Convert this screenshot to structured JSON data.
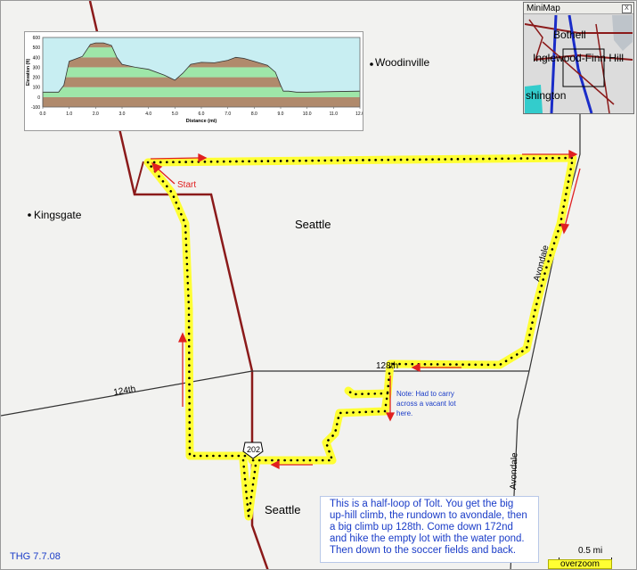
{
  "map": {
    "places": {
      "woodinville": "Woodinville",
      "kingsgate": "Kingsgate",
      "seattle_top": "Seattle",
      "seattle_bottom": "Seattle"
    },
    "roads": {
      "r124th": "124th",
      "r128th": "128th",
      "avondale_upper": "Avondale",
      "avondale_lower": "Avondale",
      "shield_202": "202"
    },
    "start_label": "Start",
    "note_pin": "Note: Had to carry\nacross a vacant lot\nhere.",
    "route_color": "#ffff33",
    "road_color": "#8b1a1a",
    "arrow_color": "#e02020"
  },
  "note_box": "This is a half-loop of Tolt. You get the big up-hill climb, the rundown to avondale, then a big climb up 128th. Come down 172nd and hike the empty lot with the water pond. Then down to the soccer fields and back.",
  "credit": "THG 7.7.08",
  "scale": {
    "label": "0.5 mi",
    "overzoom": "overzoom"
  },
  "minimap": {
    "title": "MiniMap",
    "close": "X",
    "labels": {
      "bothell": "Bothell",
      "inglewood": "Inglewood-Finn Hill",
      "washington": "shington"
    }
  },
  "profile": {
    "ylabel": "Elevation (ft)",
    "xlabel": "Distance  (mi)",
    "y_ticks": [
      "600",
      "500",
      "400",
      "300",
      "200",
      "100",
      "0",
      "-100"
    ],
    "x_ticks": [
      "0.0",
      "1.0",
      "2.0",
      "3.0",
      "4.0",
      "5.0",
      "6.0",
      "7.0",
      "8.0",
      "9.0",
      "10.0",
      "11.0",
      "12.0"
    ]
  },
  "chart_data": {
    "type": "area",
    "xlabel": "Distance  (mi)",
    "ylabel": "Elevation (ft)",
    "xlim": [
      0,
      12
    ],
    "ylim": [
      -100,
      600
    ],
    "x": [
      0.0,
      0.6,
      0.8,
      1.0,
      1.5,
      1.8,
      2.0,
      2.3,
      2.6,
      2.8,
      3.0,
      3.5,
      4.0,
      4.6,
      5.0,
      5.3,
      5.6,
      6.0,
      6.5,
      7.0,
      7.3,
      7.6,
      8.0,
      8.5,
      8.8,
      9.0,
      9.1,
      9.3,
      9.6,
      10.0,
      11.0,
      12.0
    ],
    "values": [
      50,
      50,
      120,
      360,
      410,
      530,
      545,
      545,
      520,
      400,
      330,
      300,
      280,
      220,
      170,
      240,
      330,
      350,
      345,
      370,
      400,
      390,
      360,
      320,
      250,
      120,
      60,
      60,
      50,
      50,
      55,
      60
    ]
  }
}
